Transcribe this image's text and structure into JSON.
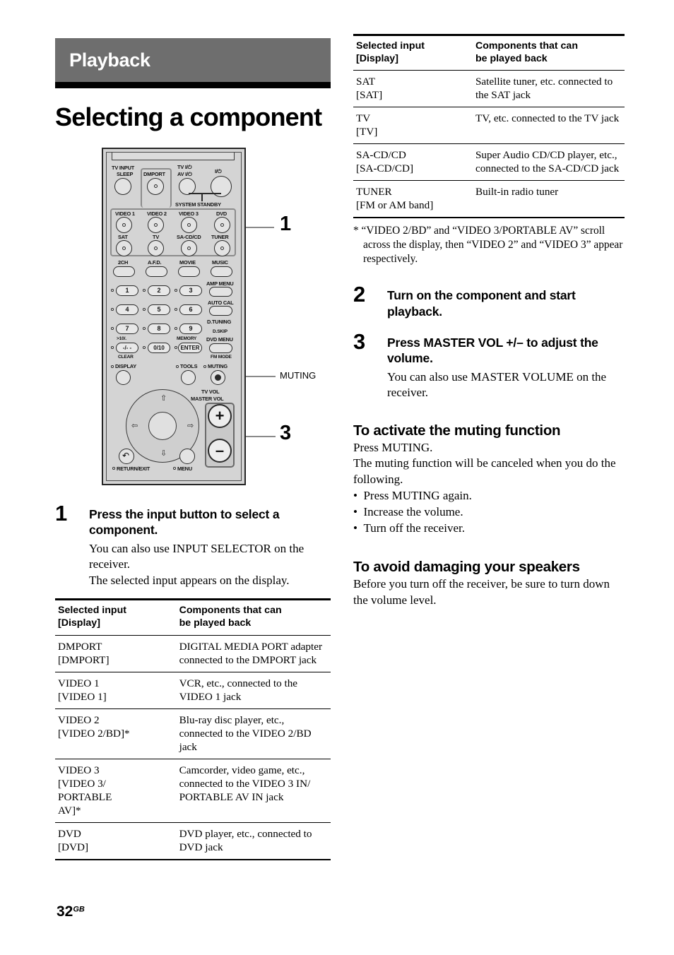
{
  "banner": {
    "chapter": "Playback"
  },
  "page_title": "Selecting a component",
  "remote": {
    "labels": {
      "tv_input": "TV INPUT",
      "sleep": "SLEEP",
      "dmport": "DMPORT",
      "tv_power": "TV I/⏻",
      "av_power": "AV I/⏻",
      "main_power": "I/⏻",
      "system_standby": "SYSTEM STANDBY",
      "video1": "VIDEO 1",
      "video2": "VIDEO 2",
      "video3": "VIDEO 3",
      "dvd": "DVD",
      "sat": "SAT",
      "tv": "TV",
      "sacdcd": "SA-CD/CD",
      "tuner": "TUNER",
      "two_ch": "2CH",
      "afd": "A.F.D.",
      "movie": "MOVIE",
      "music": "MUSIC",
      "amp_menu": "AMP MENU",
      "auto_cal": "AUTO CAL",
      "d_tuning": "D.TUNING",
      "d_skip": "D.SKIP",
      "dvd_menu": "DVD MENU",
      "fm_mode": "FM MODE",
      "memory": "MEMORY",
      "enter": "ENTER",
      "clear": "CLEAR",
      "ten_plus": ">10/.",
      "minus_dash": "-/- -",
      "zero_ten": "0/10",
      "display": "DISPLAY",
      "tools": "TOOLS",
      "muting": "MUTING",
      "tv_vol": "TV VOL",
      "master_vol": "MASTER VOL",
      "return_exit": "RETURN/EXIT",
      "menu": "MENU",
      "num1": "1",
      "num2": "2",
      "num3": "3",
      "num4": "4",
      "num5": "5",
      "num6": "6",
      "num7": "7",
      "num8": "8",
      "num9": "9",
      "plus": "+",
      "minus": "–"
    },
    "callouts": {
      "input_buttons": "1",
      "muting_button": "MUTING",
      "master_vol_buttons": "3"
    }
  },
  "steps": [
    {
      "num": "1",
      "heading": "Press the input button to select a component.",
      "body": "You can also use INPUT SELECTOR on the receiver.\nThe selected input appears on the display."
    },
    {
      "num": "2",
      "heading": "Turn on the component and start playback.",
      "body": ""
    },
    {
      "num": "3",
      "heading": "Press MASTER VOL +/– to adjust the volume.",
      "body": "You can also use MASTER VOLUME on the receiver."
    }
  ],
  "table": {
    "headers": [
      "Selected input\n[Display]",
      "Components that can\nbe played back"
    ],
    "header_col1_line1": "Selected input",
    "header_col1_line2": "[Display]",
    "header_col2_line1": "Components that can",
    "header_col2_line2": "be played back",
    "rows_left": [
      {
        "input": "DMPORT\n[DMPORT]",
        "components": "DIGITAL MEDIA PORT adapter connected to the DMPORT jack"
      },
      {
        "input": "VIDEO 1\n[VIDEO 1]",
        "components": "VCR, etc., connected to the VIDEO 1 jack"
      },
      {
        "input": "VIDEO 2\n[VIDEO 2/BD]*",
        "components": "Blu-ray disc player, etc., connected to the VIDEO 2/BD jack"
      },
      {
        "input": "VIDEO 3\n[VIDEO 3/\nPORTABLE\nAV]*",
        "components": "Camcorder, video game, etc., connected to the VIDEO 3 IN/\nPORTABLE AV IN jack"
      },
      {
        "input": "DVD\n[DVD]",
        "components": "DVD player, etc., connected to DVD jack"
      }
    ],
    "rows_right": [
      {
        "input": "SAT\n[SAT]",
        "components": "Satellite tuner, etc. connected to the SAT jack"
      },
      {
        "input": "TV\n[TV]",
        "components": "TV, etc. connected to the TV jack"
      },
      {
        "input": "SA-CD/CD\n[SA-CD/CD]",
        "components": "Super Audio CD/CD player, etc., connected to the SA-CD/CD jack"
      },
      {
        "input": "TUNER\n[FM or AM band]",
        "components": "Built-in radio tuner"
      }
    ],
    "footnote": "* “VIDEO 2/BD” and “VIDEO 3/PORTABLE AV” scroll across the display, then “VIDEO 2” and “VIDEO 3” appear respectively."
  },
  "sections": [
    {
      "heading": "To activate the muting function",
      "para1": "Press MUTING.",
      "para2": "The muting function will be canceled when you do the following.",
      "bullets": [
        "Press MUTING again.",
        "Increase the volume.",
        "Turn off the receiver."
      ]
    },
    {
      "heading": "To avoid damaging your speakers",
      "para1": "Before you turn off the receiver, be sure to turn down the volume level.",
      "para2": "",
      "bullets": []
    }
  ],
  "footer": {
    "page_number": "32",
    "region": "GB"
  },
  "colors": {
    "banner_bg": "#6e6e6e",
    "rule": "#000000",
    "remote_body": "#d4d4d4",
    "callout": "#8a8a8a"
  }
}
